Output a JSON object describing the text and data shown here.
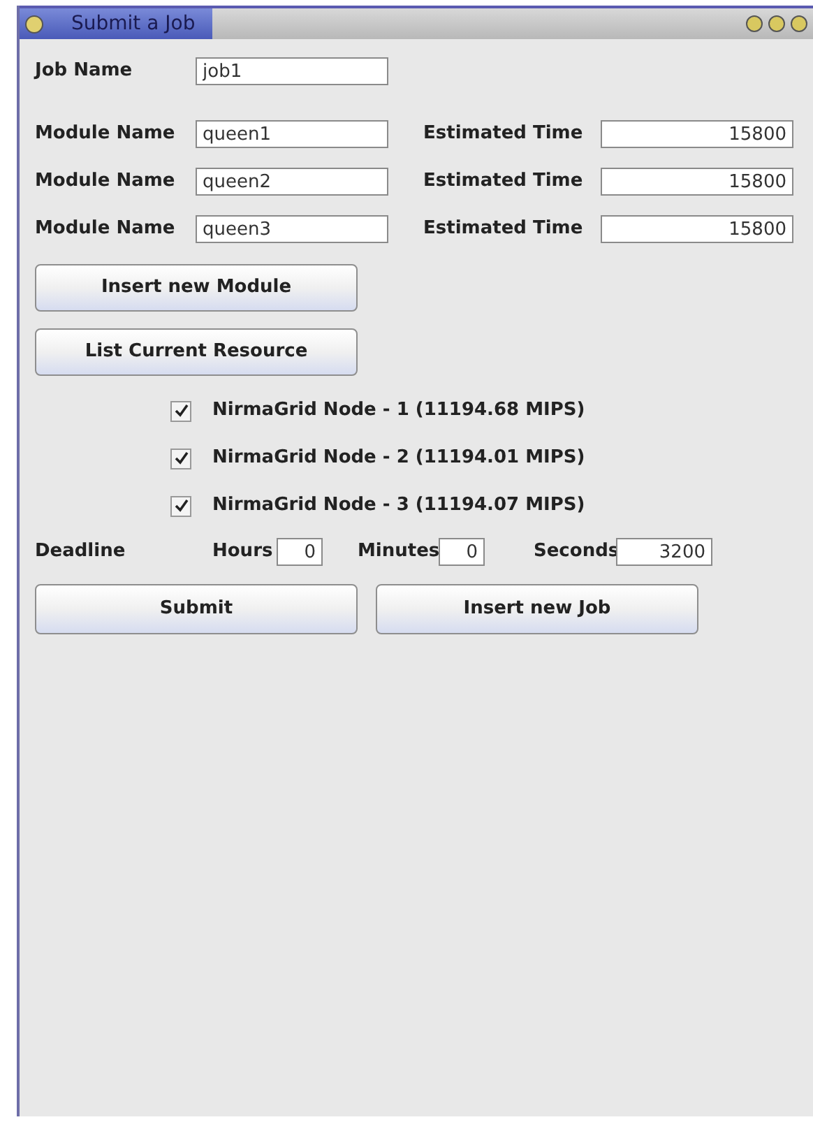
{
  "window": {
    "title": "Submit a Job"
  },
  "job_name": {
    "label": "Job Name",
    "value": "job1"
  },
  "modules": [
    {
      "name_label": "Module Name",
      "name": "queen1",
      "time_label": "Estimated Time",
      "time": "15800"
    },
    {
      "name_label": "Module Name",
      "name": "queen2",
      "time_label": "Estimated Time",
      "time": "15800"
    },
    {
      "name_label": "Module Name",
      "name": "queen3",
      "time_label": "Estimated Time",
      "time": "15800"
    }
  ],
  "insert_module_button": "Insert new Module",
  "list_resource_button": "List Current Resource",
  "resources": [
    {
      "label": "NirmaGrid Node - 1 (11194.68 MIPS)",
      "checked": true
    },
    {
      "label": "NirmaGrid Node - 2 (11194.01 MIPS)",
      "checked": true
    },
    {
      "label": "NirmaGrid Node - 3 (11194.07 MIPS)",
      "checked": true
    }
  ],
  "deadline": {
    "label": "Deadline",
    "hours_label": "Hours",
    "hours": "0",
    "minutes_label": "Minutes",
    "minutes": "0",
    "seconds_label": "Seconds",
    "seconds": "3200"
  },
  "buttons": [
    "Submit",
    "Insert new Job"
  ]
}
